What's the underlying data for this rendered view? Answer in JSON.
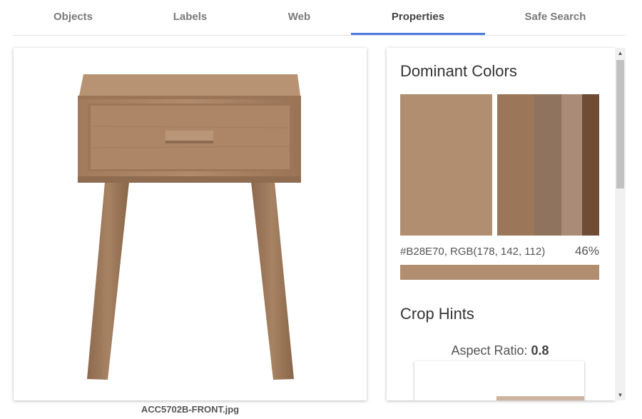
{
  "tabs": [
    {
      "label": "Objects"
    },
    {
      "label": "Labels"
    },
    {
      "label": "Web"
    },
    {
      "label": "Properties"
    },
    {
      "label": "Safe Search"
    }
  ],
  "active_tab": "Properties",
  "image": {
    "file_name": "ACC5702B-FRONT.jpg",
    "subject": "wooden nightstand"
  },
  "properties": {
    "dominant_colors_title": "Dominant Colors",
    "primary_color": {
      "hex": "#B28E70",
      "label": "#B28E70,  RGB(178, 142, 112)",
      "percent": "46%"
    },
    "secondary_colors": [
      "#9c7659",
      "#8f735e",
      "#aa8b78",
      "#6e4c35"
    ],
    "crop_hints_title": "Crop Hints",
    "aspect_ratio_label": "Aspect Ratio:",
    "aspect_ratio_value": "0.8"
  },
  "colors": {
    "accent": "#4a7bdc",
    "tab_text": "#7a7a7a"
  },
  "scrollbar": {
    "up_icon": "triangle-up",
    "down_icon": "triangle-down"
  }
}
